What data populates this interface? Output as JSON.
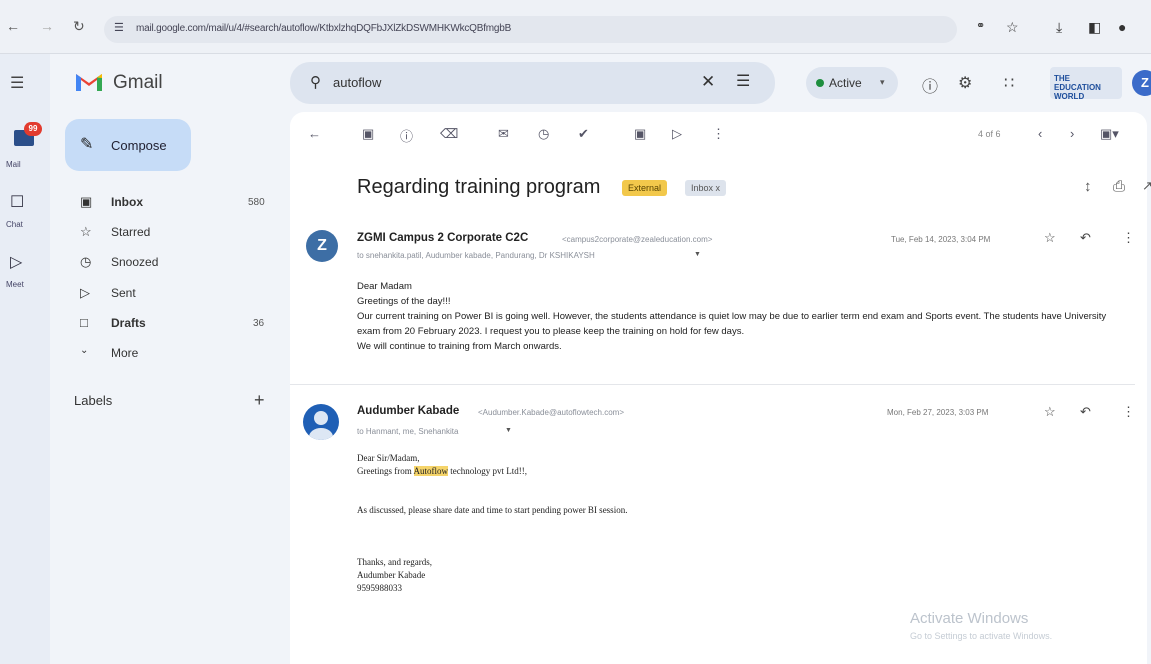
{
  "browser": {
    "url": "mail.google.com/mail/u/4/#search/autoflow/KtbxlzhqDQFbJXlZkDSWMHKWkcQBfmgbB"
  },
  "rail": {
    "items": [
      {
        "label": "Mail",
        "badge": "99"
      },
      {
        "label": "Chat"
      },
      {
        "label": "Meet"
      }
    ]
  },
  "app": {
    "name": "Gmail"
  },
  "compose": {
    "label": "Compose"
  },
  "sidebar": {
    "items": [
      {
        "label": "Inbox",
        "count": "580",
        "icon": "inbox-icon"
      },
      {
        "label": "Starred",
        "count": "",
        "icon": "star-icon"
      },
      {
        "label": "Snoozed",
        "count": "",
        "icon": "clock-icon"
      },
      {
        "label": "Sent",
        "count": "",
        "icon": "send-icon"
      },
      {
        "label": "Drafts",
        "count": "36",
        "icon": "draft-icon"
      },
      {
        "label": "More",
        "count": "",
        "icon": "chevron-down-icon"
      }
    ],
    "labels_title": "Labels"
  },
  "search": {
    "value": "autoflow"
  },
  "status": {
    "label": "Active"
  },
  "thread": {
    "pager": "4 of 6",
    "subject": "Regarding training program",
    "badges": [
      "External",
      "Inbox x"
    ],
    "messages": [
      {
        "avatar": "Z",
        "sender": "ZGMI Campus 2 Corporate C2C",
        "email": "<campus2corporate@zealeducation.com>",
        "to": "to snehankita.patil, Audumber kabade, Pandurang, Dr KSHIKAYSH",
        "date": "Tue, Feb 14, 2023, 3:04 PM",
        "body": [
          "Dear Madam",
          "Greetings of the day!!!",
          "Our current training on Power BI is going well. However, the students attendance is quiet low may be due to earlier term end exam and Sports event. The students have University exam from 20 February 2023. I request you to please keep the training on hold for few days.",
          "We will continue to training from March onwards."
        ]
      },
      {
        "sender": "Audumber Kabade",
        "email": "<Audumber.Kabade@autoflowtech.com>",
        "to": "to Hanmant, me, Snehankita",
        "date": "Mon, Feb 27, 2023, 3:03 PM",
        "greeting": "Dear Sir/Madam,",
        "line2_prefix": "Greetings from ",
        "line2_highlight": "Autoflow",
        "line2_suffix": " technology pvt Ltd!!,",
        "line3": "As discussed, please share date and time to start pending power BI session.",
        "sign1": "Thanks, and regards,",
        "sign2": "Audumber Kabade",
        "sign3": "9595988033"
      }
    ]
  },
  "watermark": {
    "line1": "Activate Windows",
    "line2": "Go to Settings to activate Windows."
  },
  "brand": {
    "logo_text": "THE EDUCATION WORLD"
  },
  "account": {
    "initial": "Z"
  },
  "colors": {
    "accent": "#c6dcf7",
    "external_badge": "#f2c84b",
    "highlight": "#f5d46a"
  }
}
